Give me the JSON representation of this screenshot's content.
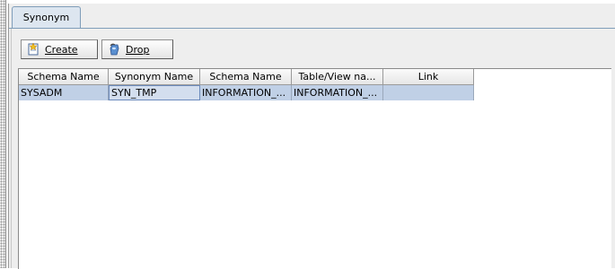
{
  "tab": {
    "label": "Synonym"
  },
  "toolbar": {
    "create_label": "Create",
    "drop_label": "Drop"
  },
  "table": {
    "columns": [
      "Schema Name",
      "Synonym Name",
      "Schema Name",
      "Table/View na...",
      "Link"
    ],
    "rows": [
      [
        "SYSADM",
        "SYN_TMP",
        "INFORMATION_...",
        "INFORMATION_...",
        ""
      ]
    ]
  },
  "colors": {
    "selected_row": "#c0d0e6",
    "tab_border": "#7f9db9"
  },
  "icons": {
    "create": "new-document-icon",
    "drop": "drop-icon"
  }
}
